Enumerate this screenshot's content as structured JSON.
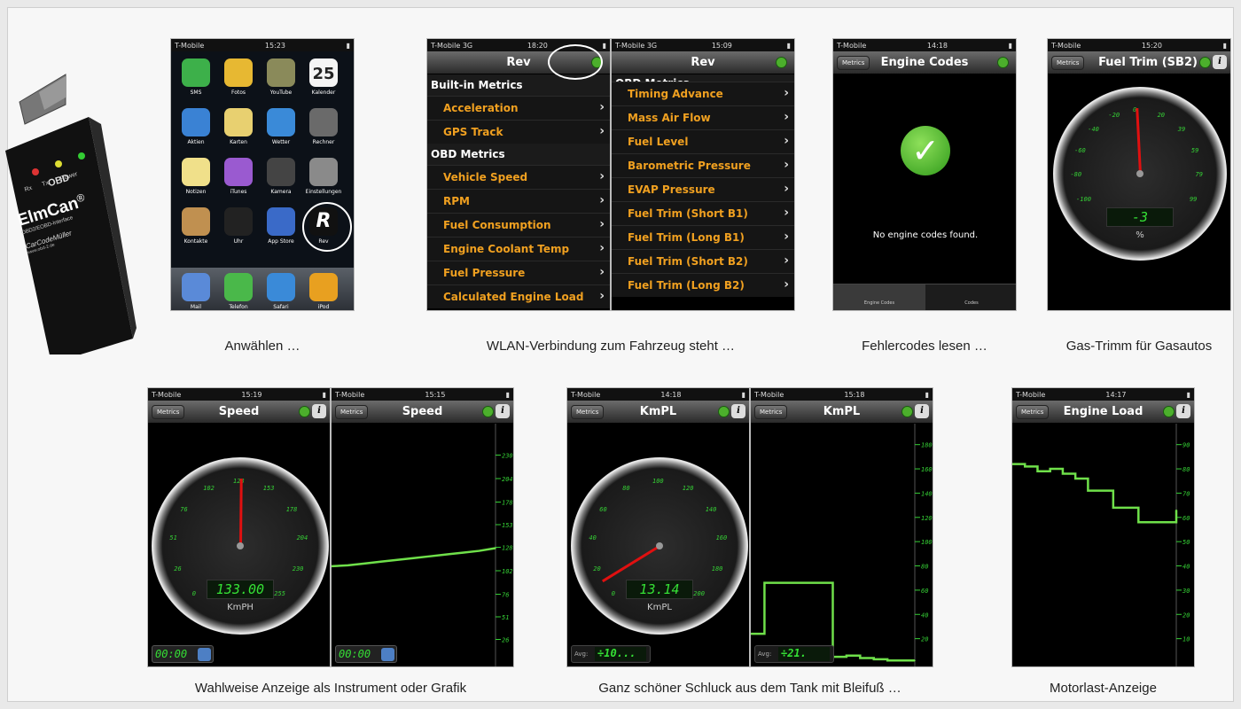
{
  "device": {
    "brand": "ElmCan",
    "registered": "®",
    "interface": "OBD2/EOBD-Interface",
    "company": "CarCodeMüller",
    "url": "www.obd-2.de",
    "obd": "OBD",
    "leds": [
      "Rx",
      "Tx",
      "Power"
    ]
  },
  "captions": {
    "home": "Anwählen …",
    "wlan": "WLAN-Verbindung zum Fahrzeug steht …",
    "codes": "Fehlercodes lesen …",
    "gas": "Gas-Trimm für Gasautos",
    "speed": "Wahlweise Anzeige als Instrument oder Grafik",
    "kmpl": "Ganz schöner Schluck aus dem Tank mit Bleifuß …",
    "load": "Motorlast-Anzeige"
  },
  "home": {
    "status_left": "T-Mobile",
    "time": "15:23",
    "calendar_day": "25",
    "apps": [
      "SMS",
      "Fotos",
      "YouTube",
      "Kalender",
      "Aktien",
      "Karten",
      "Wetter",
      "Rechner",
      "Notizen",
      "iTunes",
      "Kamera",
      "Einstellungen",
      "Kontakte",
      "Uhr",
      "App Store",
      "Rev"
    ],
    "dock": [
      "Mail",
      "Telefon",
      "Safari",
      "iPod"
    ]
  },
  "rev_left": {
    "status_left": "T-Mobile 3G",
    "time": "18:20",
    "title": "Rev",
    "section1": "Built-in Metrics",
    "builtin": [
      "Acceleration",
      "GPS Track"
    ],
    "section2": "OBD Metrics",
    "obd": [
      "Vehicle Speed",
      "RPM",
      "Fuel Consumption",
      "Engine Coolant Temp",
      "Fuel Pressure",
      "Calculated Engine Load"
    ]
  },
  "rev_right": {
    "status_left": "T-Mobile 3G",
    "time": "15:09",
    "title": "Rev",
    "section": "OBD Metrics",
    "items": [
      "Timing Advance",
      "Mass Air Flow",
      "Fuel Level",
      "Barometric Pressure",
      "EVAP Pressure",
      "Fuel Trim (Short B1)",
      "Fuel Trim (Long B1)",
      "Fuel Trim (Short B2)",
      "Fuel Trim (Long B2)"
    ]
  },
  "engine_codes": {
    "status_left": "T-Mobile",
    "time": "14:18",
    "back": "Metrics",
    "title": "Engine Codes",
    "message": "No engine codes found.",
    "tabs": [
      "Engine Codes",
      "Codes"
    ]
  },
  "fuel_trim": {
    "status_left": "T-Mobile",
    "time": "15:20",
    "back": "Metrics",
    "title": "Fuel Trim (SB2)",
    "value": "-3",
    "unit": "%",
    "ticks": [
      "-100",
      "-80",
      "-60",
      "-40",
      "-20",
      "0",
      "20",
      "39",
      "59",
      "79",
      "99"
    ]
  },
  "speed_gauge": {
    "status_left": "T-Mobile",
    "time": "15:19",
    "back": "Metrics",
    "title": "Speed",
    "value": "133.00",
    "unit": "KmPH",
    "timer": "00:00",
    "ticks": [
      "0",
      "26",
      "51",
      "76",
      "102",
      "128",
      "153",
      "178",
      "204",
      "230",
      "255"
    ],
    "needle_value": 128
  },
  "speed_graph": {
    "time": "15:15",
    "back": "Metrics",
    "title": "Speed",
    "timer": "00:00",
    "scale": [
      "230",
      "204",
      "178",
      "153",
      "128",
      "102",
      "76",
      "51",
      "26"
    ],
    "chart_data": {
      "type": "line",
      "x": [
        0,
        1,
        2,
        3,
        4,
        5,
        6,
        7,
        8,
        9,
        10
      ],
      "values": [
        107,
        108,
        110,
        112,
        114,
        116,
        118,
        120,
        122,
        124,
        127
      ],
      "ylim": [
        0,
        255
      ]
    }
  },
  "kmpl_gauge": {
    "status_left": "T-Mobile",
    "time": "14:18",
    "back": "Metrics",
    "title": "KmPL",
    "value": "13.14",
    "unit": "KmPL",
    "avg_label": "Avg:",
    "avg": "÷10...",
    "ticks": [
      "0",
      "20",
      "40",
      "60",
      "80",
      "100",
      "120",
      "140",
      "160",
      "180",
      "200"
    ],
    "needle_value": 13.14
  },
  "kmpl_graph": {
    "status_left": "T-Mobile",
    "time": "15:18",
    "back": "Metrics",
    "title": "KmPL",
    "avg_label": "Avg:",
    "avg": "÷21.",
    "scale": [
      "180",
      "160",
      "140",
      "120",
      "100",
      "80",
      "60",
      "40",
      "20"
    ],
    "chart_data": {
      "type": "line",
      "x": [
        0,
        1,
        2,
        3,
        4,
        5,
        6,
        7,
        8,
        9,
        10,
        11,
        12
      ],
      "values": [
        24,
        66,
        66,
        66,
        66,
        66,
        5,
        6,
        4,
        3,
        2,
        2,
        2
      ],
      "ylim": [
        0,
        190
      ]
    }
  },
  "engine_load": {
    "status_left": "T-Mobile",
    "time": "14:17",
    "back": "Metrics",
    "title": "Engine Load",
    "scale": [
      "90",
      "80",
      "70",
      "60",
      "50",
      "40",
      "30",
      "20",
      "10"
    ],
    "chart_data": {
      "type": "line",
      "x": [
        0,
        1,
        2,
        3,
        4,
        5,
        6,
        7,
        8,
        9,
        10,
        11,
        12,
        13
      ],
      "values": [
        82,
        81,
        79,
        80,
        78,
        76,
        71,
        71,
        64,
        64,
        58,
        58,
        58,
        63
      ],
      "ylim": [
        0,
        95
      ]
    }
  }
}
